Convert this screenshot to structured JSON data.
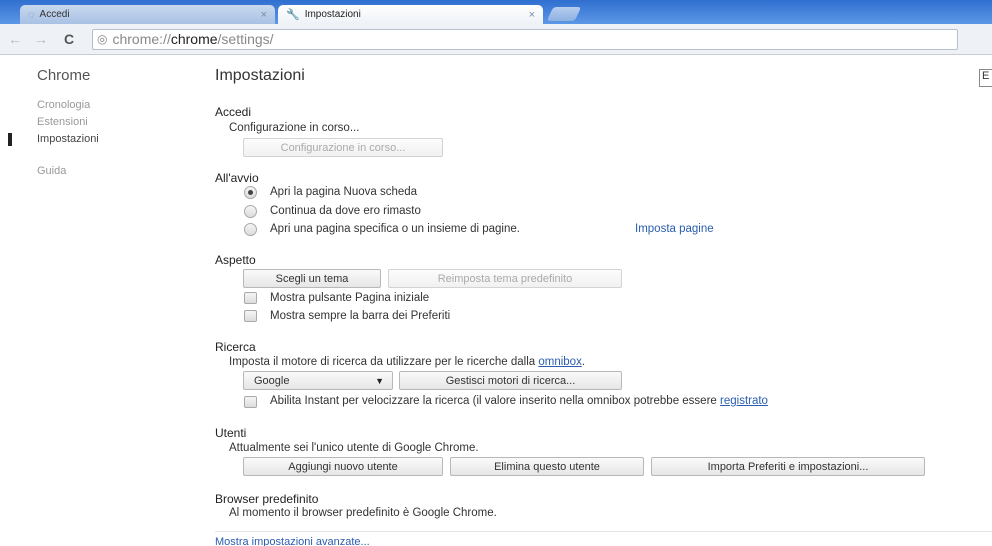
{
  "tabs": [
    {
      "label": "Accedi",
      "icon": "globe-icon",
      "close": "×"
    },
    {
      "label": "Impostazioni",
      "icon": "wrench-icon",
      "close": "×"
    }
  ],
  "toolbar": {
    "back_icon": "←",
    "forward_icon": "→",
    "reload_icon": "C",
    "url_scheme": "chrome://",
    "url_host": "chrome",
    "url_path": "/settings/"
  },
  "sidebar": {
    "title": "Chrome",
    "items": [
      {
        "label": "Cronologia"
      },
      {
        "label": "Estensioni"
      },
      {
        "label": "Impostazioni"
      },
      {
        "label": "Guida"
      }
    ]
  },
  "main": {
    "title": "Impostazioni",
    "search_stub": "E",
    "signin": {
      "title": "Accedi",
      "status": "Configurazione in corso...",
      "button": "Configurazione in corso..."
    },
    "startup": {
      "title": "All'avvio",
      "options": [
        "Apri la pagina Nuova scheda",
        "Continua da dove ero rimasto",
        "Apri una pagina specifica o un insieme di pagine."
      ],
      "set_pages_link": "Imposta pagine"
    },
    "appearance": {
      "title": "Aspetto",
      "theme_button": "Scegli un tema",
      "reset_theme_button": "Reimposta tema predefinito",
      "show_home": "Mostra pulsante Pagina iniziale",
      "show_bookmarks": "Mostra sempre la barra dei Preferiti"
    },
    "search": {
      "title": "Ricerca",
      "description": "Imposta il motore di ricerca da utilizzare per le ricerche dalla",
      "omnibox_link": "omnibox",
      "engine": "Google",
      "manage_button": "Gestisci motori di ricerca...",
      "instant_text": "Abilita Instant per velocizzare la ricerca (il valore inserito nella omnibox potrebbe essere",
      "instant_link": "registrato"
    },
    "users": {
      "title": "Utenti",
      "description": "Attualmente sei l'unico utente di Google Chrome.",
      "add_button": "Aggiungi nuovo utente",
      "delete_button": "Elimina questo utente",
      "import_button": "Importa Preferiti e impostazioni..."
    },
    "default_browser": {
      "title": "Browser predefinito",
      "description": "Al momento il browser predefinito è Google Chrome."
    },
    "advanced_link": "Mostra impostazioni avanzate..."
  }
}
